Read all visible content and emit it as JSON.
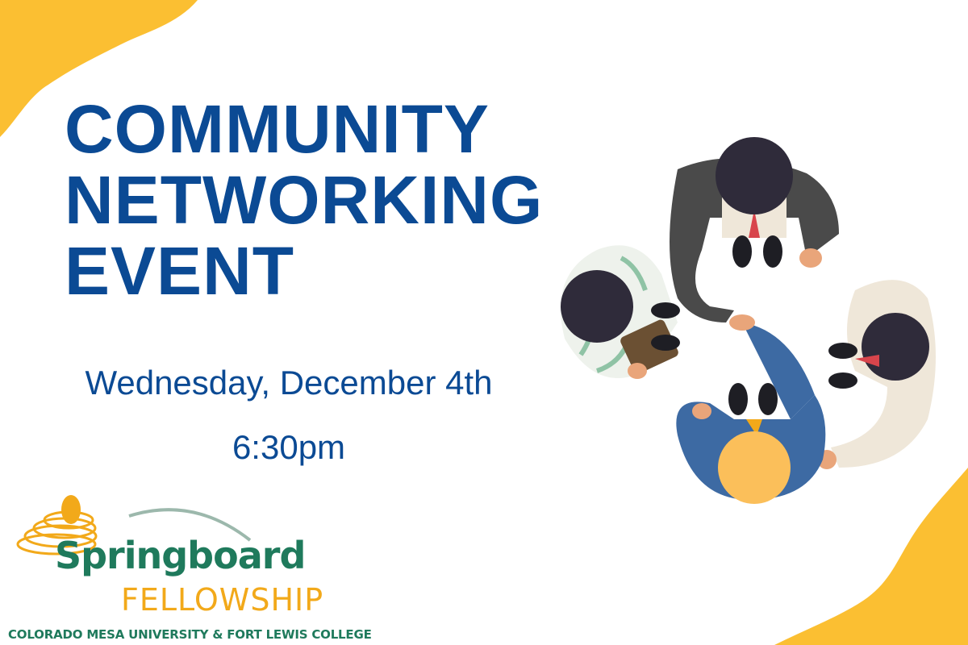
{
  "headline": {
    "line1": "COMMUNITY",
    "line2": "NETWORKING",
    "line3": "EVENT"
  },
  "event": {
    "date": "Wednesday, December 4th",
    "time": "6:30pm"
  },
  "logo": {
    "word1": "Springboard",
    "word2": "FELLOWSHIP",
    "subtitle": "COLORADO MESA UNIVERSITY & FORT LEWIS COLLEGE"
  },
  "colors": {
    "headline_blue": "#0b4a94",
    "accent_yellow": "#fbbf32",
    "logo_green": "#1f7a5c",
    "logo_gold": "#f2a91a"
  },
  "illustration": {
    "icon": "business-handshake-illustration"
  }
}
